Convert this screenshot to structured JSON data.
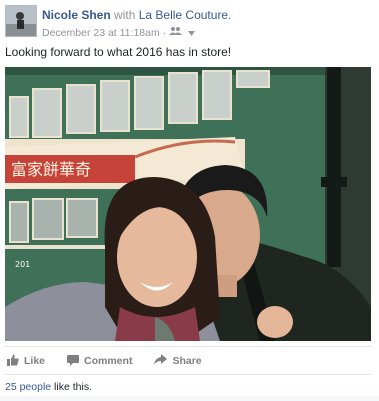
{
  "post": {
    "author": "Nicole Shen",
    "with_text": "with",
    "tagged_page": "La Belle Couture.",
    "timestamp": "December 23 at 11:18am",
    "separator": "·",
    "audience_icon": "friends-icon",
    "status_text": "Looking forward to what 2016 has in store!",
    "photo_description_icon": "photo"
  },
  "actions": {
    "like_label": "Like",
    "comment_label": "Comment",
    "share_label": "Share"
  },
  "likes": {
    "count_text": "25 people",
    "suffix": " like this."
  },
  "photo_sign": {
    "chinese_text": "富家餅華奇",
    "tram_number": "201"
  },
  "colors": {
    "link": "#365899",
    "meta": "#90949c",
    "action": "#7f7f7f",
    "tram_green": "#3f7058",
    "sign_red": "#c6433a"
  }
}
